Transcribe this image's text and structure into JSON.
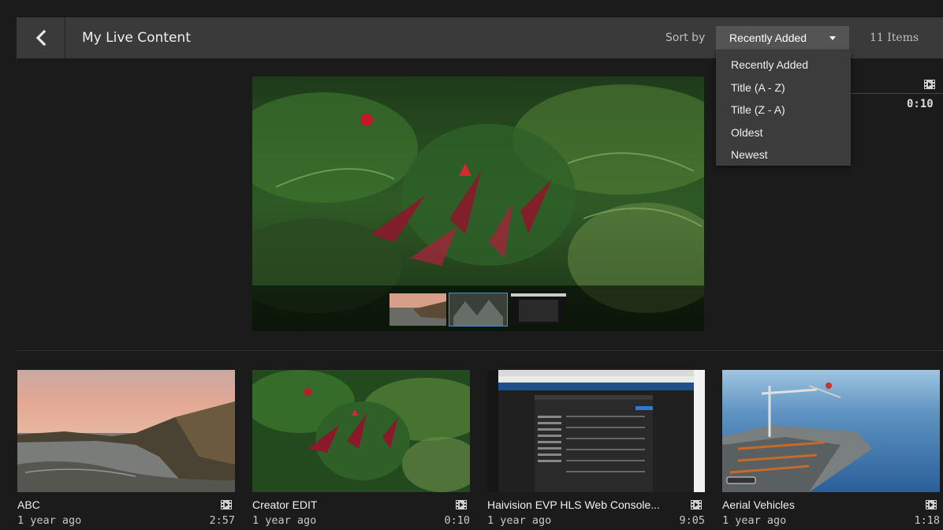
{
  "header": {
    "title": "My Live Content",
    "sort_label": "Sort by",
    "sort_selected": "Recently Added",
    "item_count": "11 Items"
  },
  "sort_options": [
    "Recently Added",
    "Title (A - Z)",
    "Title (Z - A)",
    "Oldest",
    "Newest"
  ],
  "featured": {
    "duration": "0:10"
  },
  "cards": [
    {
      "title": "ABC",
      "age": "1 year ago",
      "duration": "2:57"
    },
    {
      "title": "Creator EDIT",
      "age": "1 year ago",
      "duration": "0:10"
    },
    {
      "title": "Haivision EVP HLS Web Console...",
      "age": "1 year ago",
      "duration": "9:05"
    },
    {
      "title": "Aerial Vehicles",
      "age": "1 year ago",
      "duration": "1:18"
    }
  ],
  "colors": {
    "background": "#1b1b1b",
    "header_bar": "#3a3a3a",
    "select_bg": "#545454",
    "dropdown_bg": "#3c3c3c",
    "selected_outline": "#4a90d9"
  }
}
